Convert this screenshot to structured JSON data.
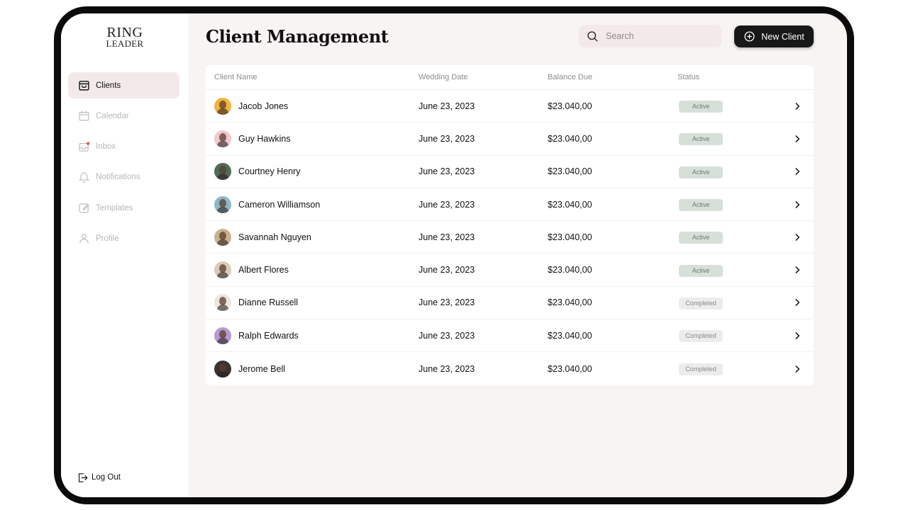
{
  "logo": {
    "line1": "RING",
    "line2": "LEADER"
  },
  "sidebar": {
    "items": [
      {
        "label": "Clients",
        "icon": "store-icon",
        "active": true
      },
      {
        "label": "Calendar",
        "icon": "calendar-icon",
        "active": false
      },
      {
        "label": "Inbox",
        "icon": "inbox-icon",
        "active": false
      },
      {
        "label": "Notifications",
        "icon": "bell-icon",
        "active": false
      },
      {
        "label": "Templates",
        "icon": "edit-icon",
        "active": false
      },
      {
        "label": "Profile",
        "icon": "user-icon",
        "active": false
      }
    ],
    "logout_label": "Log Out"
  },
  "header": {
    "title": "Client Management",
    "search_placeholder": "Search",
    "new_client_label": "New Client"
  },
  "table": {
    "columns": [
      "Client Name",
      "Wedding Date",
      "Balance Due",
      "Status"
    ],
    "rows": [
      {
        "name": "Jacob Jones",
        "date": "June 23, 2023",
        "balance": "$23.040,00",
        "status": "Active",
        "avatar_color": "#f2b33a"
      },
      {
        "name": "Guy Hawkins",
        "date": "June 23, 2023",
        "balance": "$23.040,00",
        "status": "Active",
        "avatar_color": "#f0c8cf"
      },
      {
        "name": "Courtney Henry",
        "date": "June 23, 2023",
        "balance": "$23.040,00",
        "status": "Active",
        "avatar_color": "#4f6b58"
      },
      {
        "name": "Cameron Williamson",
        "date": "June 23, 2023",
        "balance": "$23.040,00",
        "status": "Active",
        "avatar_color": "#8fb6c9"
      },
      {
        "name": "Savannah Nguyen",
        "date": "June 23, 2023",
        "balance": "$23.040,00",
        "status": "Active",
        "avatar_color": "#c9b28f"
      },
      {
        "name": "Albert Flores",
        "date": "June 23, 2023",
        "balance": "$23.040,00",
        "status": "Active",
        "avatar_color": "#d9cbb8"
      },
      {
        "name": "Dianne Russell",
        "date": "June 23, 2023",
        "balance": "$23.040,00",
        "status": "Completed",
        "avatar_color": "#efe5dc"
      },
      {
        "name": "Ralph Edwards",
        "date": "June 23, 2023",
        "balance": "$23.040,00",
        "status": "Completed",
        "avatar_color": "#b79ad0"
      },
      {
        "name": "Jerome Bell",
        "date": "June 23, 2023",
        "balance": "$23.040,00",
        "status": "Completed",
        "avatar_color": "#3a3230"
      }
    ]
  },
  "colors": {
    "accent_bg": "#f4e9ea",
    "active_badge": "#d6e0d9",
    "completed_badge": "#ececec",
    "button": "#181818"
  }
}
